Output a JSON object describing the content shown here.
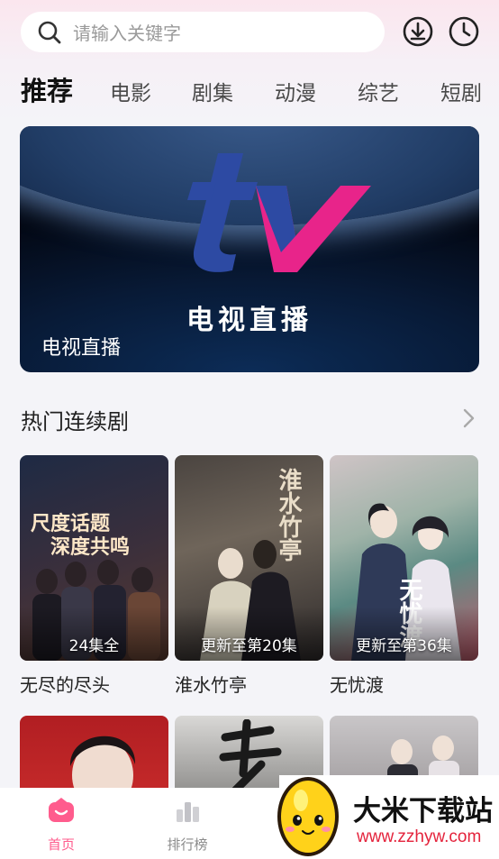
{
  "search": {
    "placeholder": "请输入关键字"
  },
  "header": {
    "download_icon": "download-icon",
    "history_icon": "clock-icon"
  },
  "tabs": [
    {
      "label": "推荐",
      "active": true
    },
    {
      "label": "电影"
    },
    {
      "label": "剧集"
    },
    {
      "label": "动漫"
    },
    {
      "label": "综艺"
    },
    {
      "label": "短剧"
    }
  ],
  "banner": {
    "logo_text": "电视直播",
    "caption": "电视直播",
    "logo_colors": {
      "t": "#2d4aa3",
      "v": "#e8248a"
    }
  },
  "section": {
    "title": "热门连续剧",
    "cards": [
      {
        "title": "无尽的尽头",
        "badge": "24集全",
        "poster_text": [
          "尺度话题",
          "深度共鸣"
        ]
      },
      {
        "title": "淮水竹亭",
        "badge": "更新至第20集",
        "poster_text": [
          "淮水竹亭"
        ]
      },
      {
        "title": "无忧渡",
        "badge": "更新至第36集",
        "poster_text": [
          "无忧渡"
        ]
      }
    ]
  },
  "nav": [
    {
      "label": "首页",
      "icon": "home-icon",
      "active": true
    },
    {
      "label": "排行榜",
      "icon": "bar-chart-icon",
      "active": false
    }
  ],
  "watermark": {
    "title": "大米下载站",
    "url": "www.zzhyw.com"
  },
  "colors": {
    "accent": "#ff5c8d",
    "background": "#f4f4f8"
  }
}
